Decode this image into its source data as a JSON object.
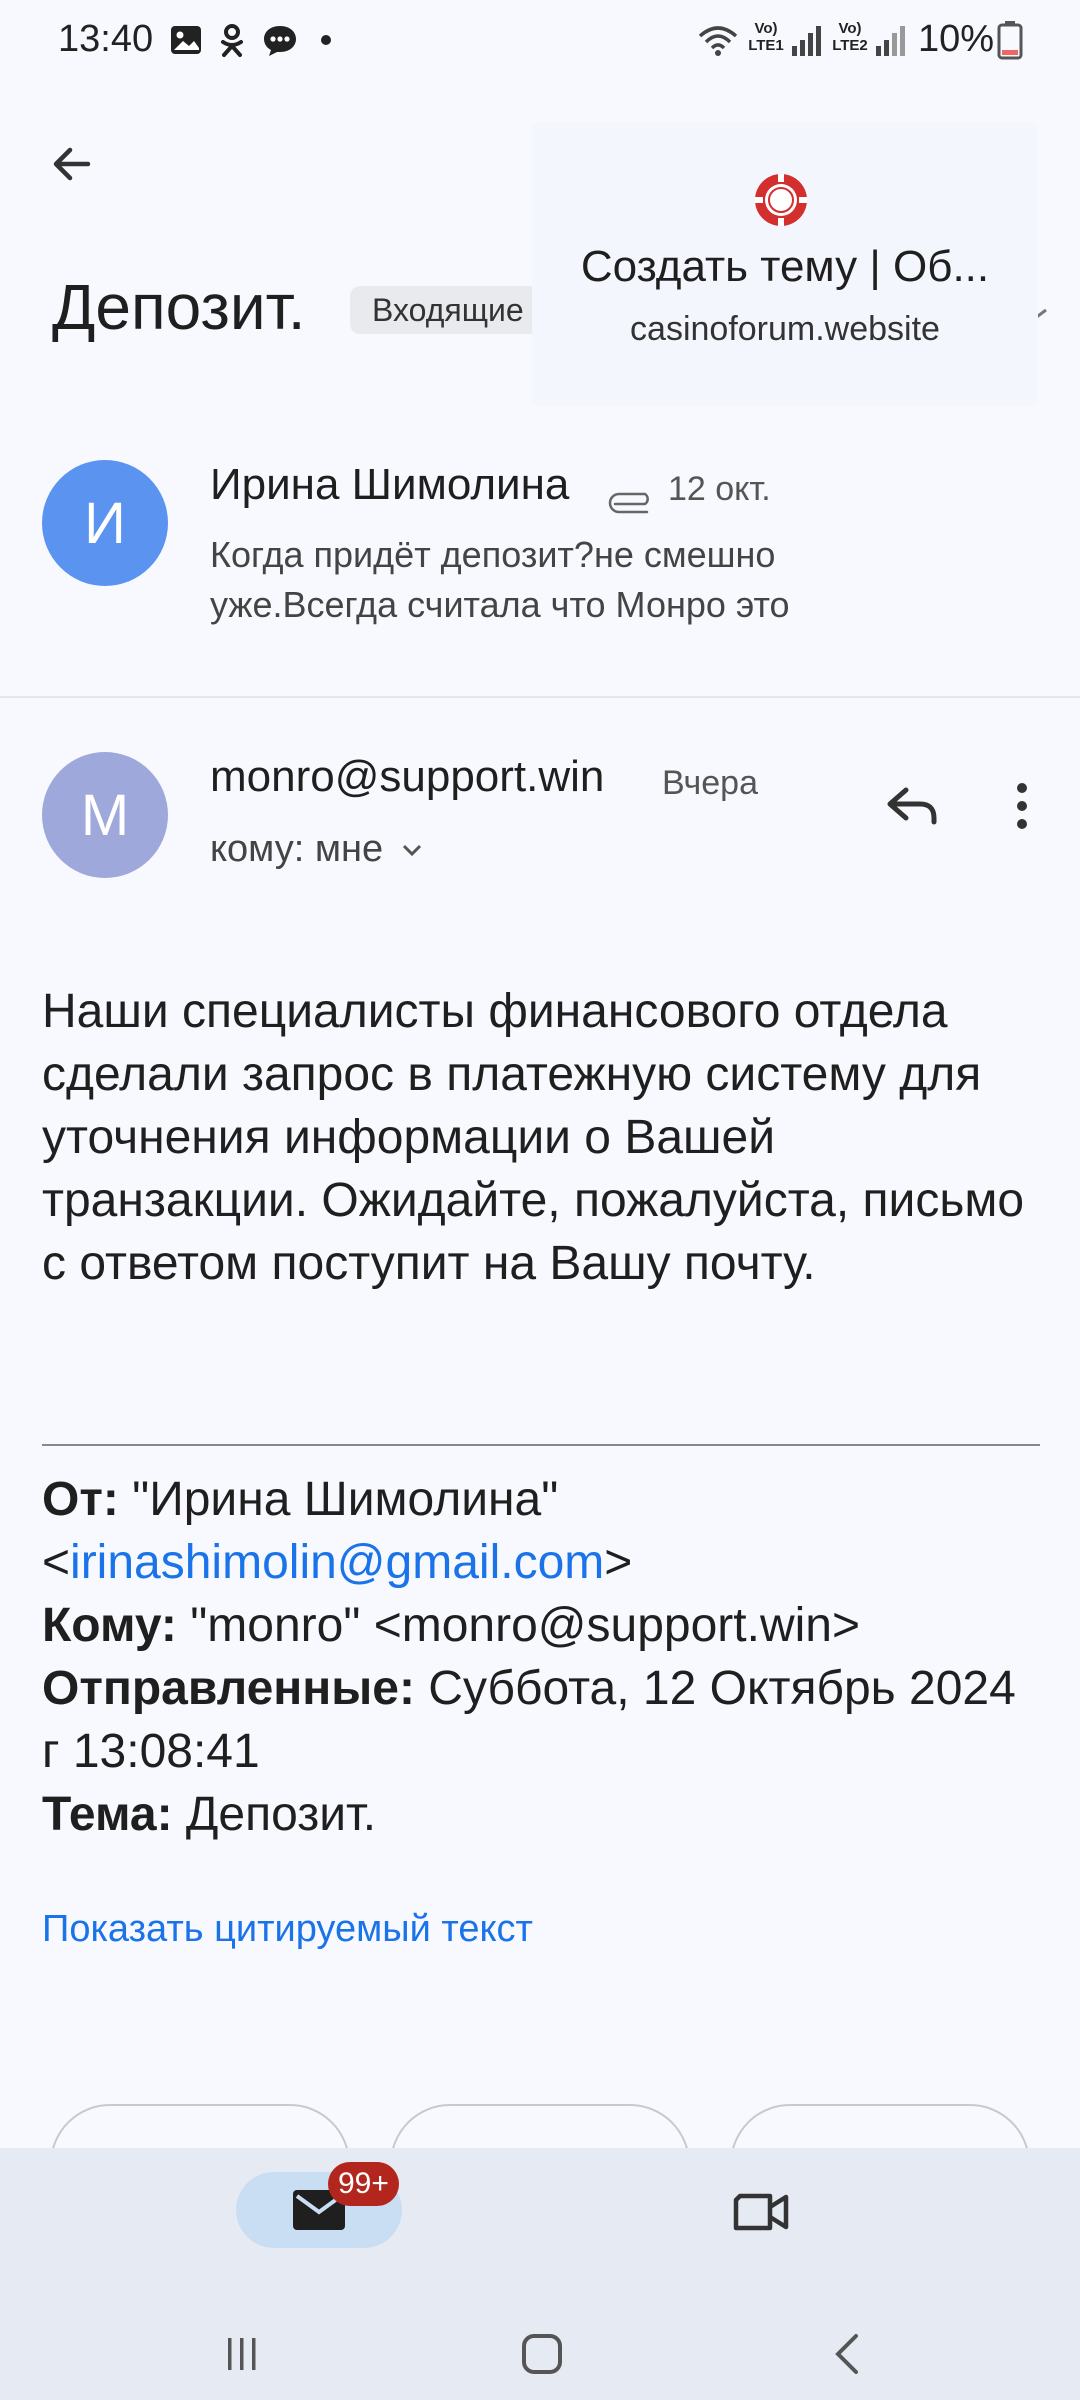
{
  "status_bar": {
    "time": "13:40",
    "battery": "10%",
    "sim1": "Vo) LTE1",
    "sim2": "Vo) LTE2"
  },
  "header": {
    "subject": "Депозит.",
    "label": "Входящие"
  },
  "link_preview": {
    "title": "Создать тему | Об...",
    "domain": "casinoforum.website"
  },
  "message1": {
    "avatar_letter": "И",
    "sender": "Ирина Шимолина",
    "date": "12 окт.",
    "snippet": "Когда придёт депозит?не смешно уже.Всегда считала что Монро это"
  },
  "message2": {
    "avatar_letter": "M",
    "sender": "monro@support.win",
    "date": "Вчера",
    "to": "кому: мне",
    "body": "Наши специалисты финансового отдела сделали запрос в платежную систему для уточнения информации о Вашей транзакции. Ожидайте, пожалуйста, письмо с ответом поступит на Вашу почту.",
    "quoted_headers": {
      "from_label": "От:",
      "from_name": " \"Ирина Шимолина\"",
      "from_email": "irinashimolin@gmail.com",
      "to_label": "Кому:",
      "to_value": " \"monro\" <monro@support.win>",
      "sent_label": "Отправленные:",
      "sent_value": " Суббота, 12 Октябрь 2024 г 13:08:41",
      "subject_label": "Тема:",
      "subject_value": " Депозит."
    },
    "show_quoted": "Показать цитируемый текст"
  },
  "bottom_nav": {
    "mail_badge": "99+"
  },
  "colors": {
    "accent": "#1a73e8",
    "avatar1": "#5b93f0",
    "avatar2": "#9fa8da",
    "badge": "#b3261e"
  },
  "icons": [
    "back-arrow-icon",
    "attachment-icon",
    "reply-icon",
    "more-vert-icon",
    "mail-icon",
    "video-icon",
    "recents-icon",
    "home-icon",
    "nav-back-icon"
  ]
}
